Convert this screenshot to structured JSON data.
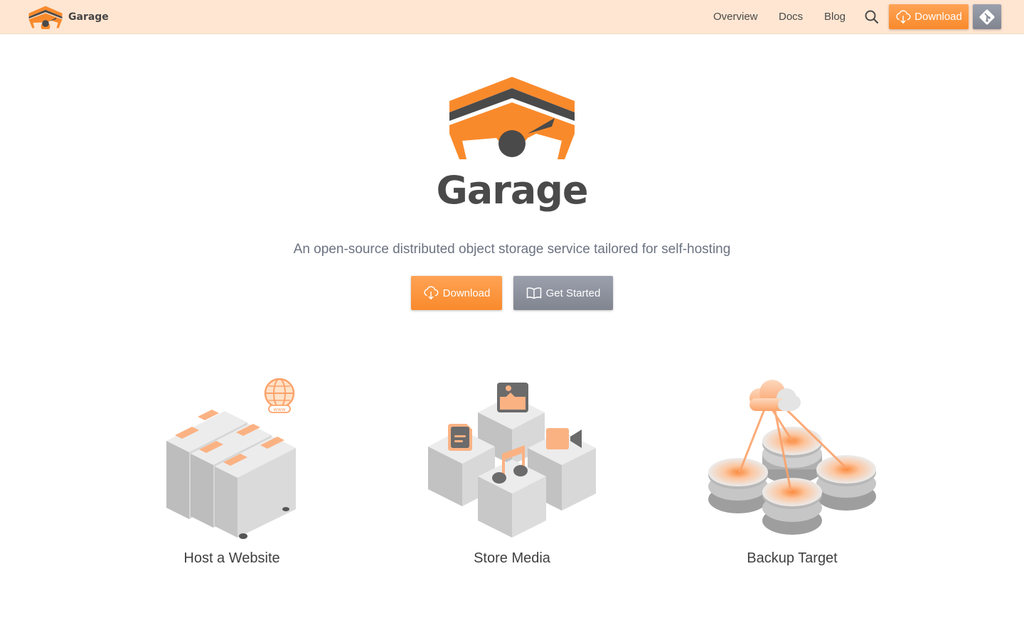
{
  "nav": {
    "brand": "Garage",
    "links": [
      "Overview",
      "Docs",
      "Blog"
    ],
    "download_label": "Download"
  },
  "hero": {
    "title": "Garage",
    "tagline": "An open-source distributed object storage service tailored for self-hosting",
    "download_label": "Download",
    "get_started_label": "Get Started"
  },
  "features": [
    {
      "label": "Host a Website",
      "icon": "web-servers-illustration"
    },
    {
      "label": "Store Media",
      "icon": "media-blocks-illustration"
    },
    {
      "label": "Backup Target",
      "icon": "backup-disks-illustration"
    }
  ],
  "colors": {
    "accent": "#f98a2c",
    "nav_bg": "#ffe6d2",
    "secondary": "#8a8f9a",
    "text": "#4a4a4a"
  }
}
